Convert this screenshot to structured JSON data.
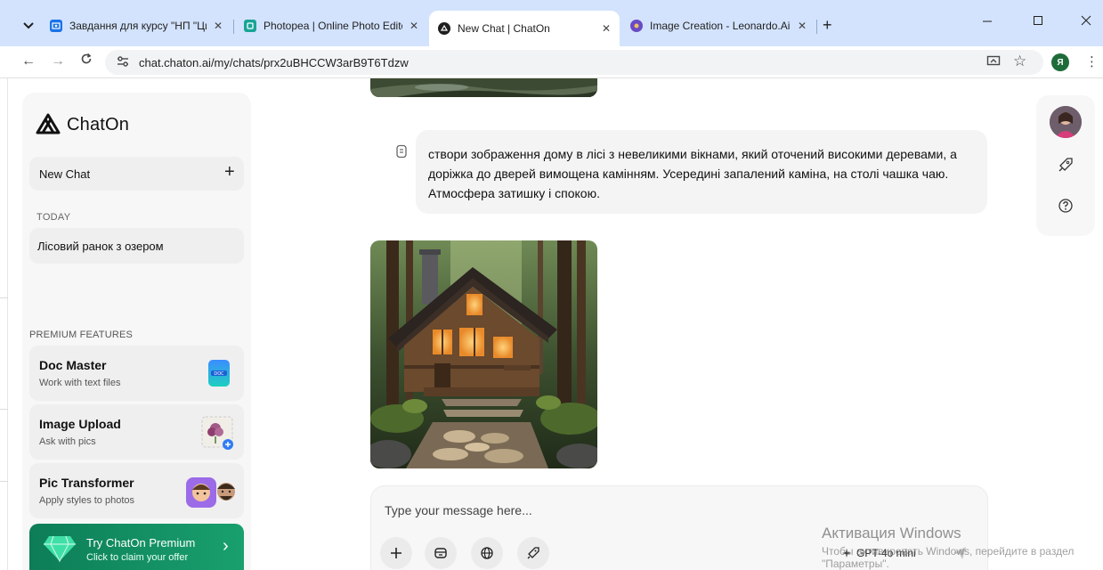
{
  "browser": {
    "tabs": [
      {
        "title": "Завдання для курсу \"НП \"Циф",
        "favicon": "classroom-icon",
        "color": "#1a73e8"
      },
      {
        "title": "Photopea | Online Photo Editor",
        "favicon": "photopea-icon",
        "color": "#18a497"
      },
      {
        "title": "New Chat | ChatOn",
        "favicon": "chaton-icon",
        "color": "#1f1f1f"
      },
      {
        "title": "Image Creation - Leonardo.Ai",
        "favicon": "leonardo-icon",
        "color": "#6a4bc4"
      }
    ],
    "url": "chat.chaton.ai/my/chats/prx2uBHCCW3arB9T6Tdzw",
    "profile_initial": "Я"
  },
  "sidebar": {
    "logo_text": "ChatOn",
    "new_chat_label": "New Chat",
    "today_label": "TODAY",
    "history": [
      {
        "label": "Лісовий ранок з озером"
      }
    ],
    "premium_features_label": "PREMIUM FEATURES",
    "features": [
      {
        "title": "Doc Master",
        "subtitle": "Work with text files",
        "icon": "doc-icon"
      },
      {
        "title": "Image Upload",
        "subtitle": "Ask with pics",
        "icon": "image-upload-icon"
      },
      {
        "title": "Pic Transformer",
        "subtitle": "Apply styles to photos",
        "icon": "avatar-styles-icon"
      }
    ],
    "premium_cta": {
      "title": "Try ChatOn Premium",
      "subtitle": "Click to claim your offer"
    }
  },
  "chat": {
    "user_message": "створи зображення дому в лісі з невеликими вікнами, який оточений високими деревами, а доріжка до дверей вимощена камінням. Усередині запалений каміна, на столі чашка чаю. Атмосфера затишку і спокою.",
    "input_placeholder": "Type your message here...",
    "model_label": "GPT-4o mini"
  },
  "watermark": {
    "title": "Активация Windows",
    "subtitle": "Чтобы активировать Windows, перейдите в раздел \"Параметры\"."
  },
  "colors": {
    "accent_green": "#19a06e",
    "tabbar_bg": "#d3e3fd",
    "sidebar_bg": "#f7f7f8"
  }
}
